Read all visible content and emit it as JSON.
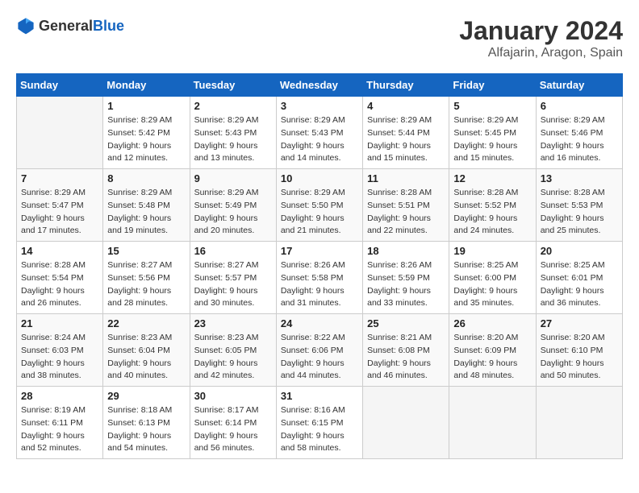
{
  "logo": {
    "general": "General",
    "blue": "Blue"
  },
  "header": {
    "month": "January 2024",
    "location": "Alfajarin, Aragon, Spain"
  },
  "weekdays": [
    "Sunday",
    "Monday",
    "Tuesday",
    "Wednesday",
    "Thursday",
    "Friday",
    "Saturday"
  ],
  "weeks": [
    [
      {
        "day": "",
        "info": ""
      },
      {
        "day": "1",
        "info": "Sunrise: 8:29 AM\nSunset: 5:42 PM\nDaylight: 9 hours\nand 12 minutes."
      },
      {
        "day": "2",
        "info": "Sunrise: 8:29 AM\nSunset: 5:43 PM\nDaylight: 9 hours\nand 13 minutes."
      },
      {
        "day": "3",
        "info": "Sunrise: 8:29 AM\nSunset: 5:43 PM\nDaylight: 9 hours\nand 14 minutes."
      },
      {
        "day": "4",
        "info": "Sunrise: 8:29 AM\nSunset: 5:44 PM\nDaylight: 9 hours\nand 15 minutes."
      },
      {
        "day": "5",
        "info": "Sunrise: 8:29 AM\nSunset: 5:45 PM\nDaylight: 9 hours\nand 15 minutes."
      },
      {
        "day": "6",
        "info": "Sunrise: 8:29 AM\nSunset: 5:46 PM\nDaylight: 9 hours\nand 16 minutes."
      }
    ],
    [
      {
        "day": "7",
        "info": "Sunrise: 8:29 AM\nSunset: 5:47 PM\nDaylight: 9 hours\nand 17 minutes."
      },
      {
        "day": "8",
        "info": "Sunrise: 8:29 AM\nSunset: 5:48 PM\nDaylight: 9 hours\nand 19 minutes."
      },
      {
        "day": "9",
        "info": "Sunrise: 8:29 AM\nSunset: 5:49 PM\nDaylight: 9 hours\nand 20 minutes."
      },
      {
        "day": "10",
        "info": "Sunrise: 8:29 AM\nSunset: 5:50 PM\nDaylight: 9 hours\nand 21 minutes."
      },
      {
        "day": "11",
        "info": "Sunrise: 8:28 AM\nSunset: 5:51 PM\nDaylight: 9 hours\nand 22 minutes."
      },
      {
        "day": "12",
        "info": "Sunrise: 8:28 AM\nSunset: 5:52 PM\nDaylight: 9 hours\nand 24 minutes."
      },
      {
        "day": "13",
        "info": "Sunrise: 8:28 AM\nSunset: 5:53 PM\nDaylight: 9 hours\nand 25 minutes."
      }
    ],
    [
      {
        "day": "14",
        "info": "Sunrise: 8:28 AM\nSunset: 5:54 PM\nDaylight: 9 hours\nand 26 minutes."
      },
      {
        "day": "15",
        "info": "Sunrise: 8:27 AM\nSunset: 5:56 PM\nDaylight: 9 hours\nand 28 minutes."
      },
      {
        "day": "16",
        "info": "Sunrise: 8:27 AM\nSunset: 5:57 PM\nDaylight: 9 hours\nand 30 minutes."
      },
      {
        "day": "17",
        "info": "Sunrise: 8:26 AM\nSunset: 5:58 PM\nDaylight: 9 hours\nand 31 minutes."
      },
      {
        "day": "18",
        "info": "Sunrise: 8:26 AM\nSunset: 5:59 PM\nDaylight: 9 hours\nand 33 minutes."
      },
      {
        "day": "19",
        "info": "Sunrise: 8:25 AM\nSunset: 6:00 PM\nDaylight: 9 hours\nand 35 minutes."
      },
      {
        "day": "20",
        "info": "Sunrise: 8:25 AM\nSunset: 6:01 PM\nDaylight: 9 hours\nand 36 minutes."
      }
    ],
    [
      {
        "day": "21",
        "info": "Sunrise: 8:24 AM\nSunset: 6:03 PM\nDaylight: 9 hours\nand 38 minutes."
      },
      {
        "day": "22",
        "info": "Sunrise: 8:23 AM\nSunset: 6:04 PM\nDaylight: 9 hours\nand 40 minutes."
      },
      {
        "day": "23",
        "info": "Sunrise: 8:23 AM\nSunset: 6:05 PM\nDaylight: 9 hours\nand 42 minutes."
      },
      {
        "day": "24",
        "info": "Sunrise: 8:22 AM\nSunset: 6:06 PM\nDaylight: 9 hours\nand 44 minutes."
      },
      {
        "day": "25",
        "info": "Sunrise: 8:21 AM\nSunset: 6:08 PM\nDaylight: 9 hours\nand 46 minutes."
      },
      {
        "day": "26",
        "info": "Sunrise: 8:20 AM\nSunset: 6:09 PM\nDaylight: 9 hours\nand 48 minutes."
      },
      {
        "day": "27",
        "info": "Sunrise: 8:20 AM\nSunset: 6:10 PM\nDaylight: 9 hours\nand 50 minutes."
      }
    ],
    [
      {
        "day": "28",
        "info": "Sunrise: 8:19 AM\nSunset: 6:11 PM\nDaylight: 9 hours\nand 52 minutes."
      },
      {
        "day": "29",
        "info": "Sunrise: 8:18 AM\nSunset: 6:13 PM\nDaylight: 9 hours\nand 54 minutes."
      },
      {
        "day": "30",
        "info": "Sunrise: 8:17 AM\nSunset: 6:14 PM\nDaylight: 9 hours\nand 56 minutes."
      },
      {
        "day": "31",
        "info": "Sunrise: 8:16 AM\nSunset: 6:15 PM\nDaylight: 9 hours\nand 58 minutes."
      },
      {
        "day": "",
        "info": ""
      },
      {
        "day": "",
        "info": ""
      },
      {
        "day": "",
        "info": ""
      }
    ]
  ]
}
